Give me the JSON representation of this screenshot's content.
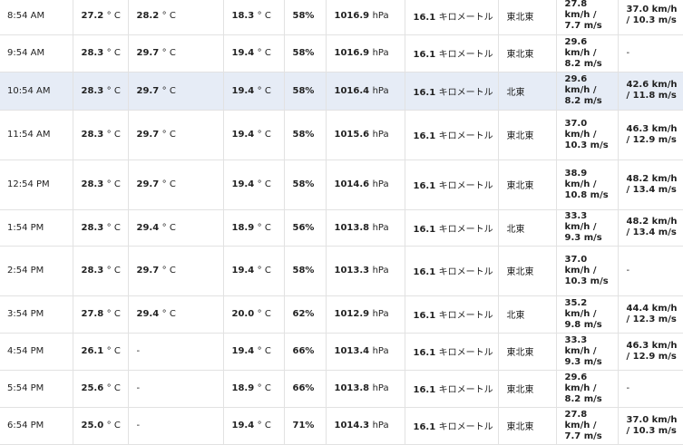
{
  "rows": [
    {
      "time": "8:54 AM",
      "temp": "27.2",
      "heat": "28.2",
      "dew": "18.3",
      "hum": "58%",
      "pres": "1016.9",
      "vis": "16.1",
      "vis_unit": "キロメートル",
      "dir": "東北東",
      "wind": "27.8 km/h / 7.7 m/s",
      "gust": "37.0 km/h / 10.3 m/s",
      "highlight": false
    },
    {
      "time": "9:54 AM",
      "temp": "28.3",
      "heat": "29.7",
      "dew": "19.4",
      "hum": "58%",
      "pres": "1016.9",
      "vis": "16.1",
      "vis_unit": "キロメートル",
      "dir": "東北東",
      "wind": "29.6 km/h / 8.2 m/s",
      "gust": "-",
      "highlight": false
    },
    {
      "time": "10:54 AM",
      "temp": "28.3",
      "heat": "29.7",
      "dew": "19.4",
      "hum": "58%",
      "pres": "1016.4",
      "vis": "16.1",
      "vis_unit": "キロメートル",
      "dir": "北東",
      "wind": "29.6 km/h / 8.2 m/s",
      "gust": "42.6 km/h / 11.8 m/s",
      "highlight": true
    },
    {
      "time": "11:54 AM",
      "temp": "28.3",
      "heat": "29.7",
      "dew": "19.4",
      "hum": "58%",
      "pres": "1015.6",
      "vis": "16.1",
      "vis_unit": "キロメートル",
      "dir": "東北東",
      "wind": "37.0 km/h / 10.3 m/s",
      "gust": "46.3 km/h / 12.9 m/s",
      "highlight": false
    },
    {
      "time": "12:54 PM",
      "temp": "28.3",
      "heat": "29.7",
      "dew": "19.4",
      "hum": "58%",
      "pres": "1014.6",
      "vis": "16.1",
      "vis_unit": "キロメートル",
      "dir": "東北東",
      "wind": "38.9 km/h / 10.8 m/s",
      "gust": "48.2 km/h / 13.4 m/s",
      "highlight": false
    },
    {
      "time": "1:54 PM",
      "temp": "28.3",
      "heat": "29.4",
      "dew": "18.9",
      "hum": "56%",
      "pres": "1013.8",
      "vis": "16.1",
      "vis_unit": "キロメートル",
      "dir": "北東",
      "wind": "33.3 km/h / 9.3 m/s",
      "gust": "48.2 km/h / 13.4 m/s",
      "highlight": false
    },
    {
      "time": "2:54 PM",
      "temp": "28.3",
      "heat": "29.7",
      "dew": "19.4",
      "hum": "58%",
      "pres": "1013.3",
      "vis": "16.1",
      "vis_unit": "キロメートル",
      "dir": "東北東",
      "wind": "37.0 km/h / 10.3 m/s",
      "gust": "-",
      "highlight": false
    },
    {
      "time": "3:54 PM",
      "temp": "27.8",
      "heat": "29.4",
      "dew": "20.0",
      "hum": "62%",
      "pres": "1012.9",
      "vis": "16.1",
      "vis_unit": "キロメートル",
      "dir": "北東",
      "wind": "35.2 km/h / 9.8 m/s",
      "gust": "44.4 km/h / 12.3 m/s",
      "highlight": false
    },
    {
      "time": "4:54 PM",
      "temp": "26.1",
      "heat": "-",
      "dew": "19.4",
      "hum": "66%",
      "pres": "1013.4",
      "vis": "16.1",
      "vis_unit": "キロメートル",
      "dir": "東北東",
      "wind": "33.3 km/h / 9.3 m/s",
      "gust": "46.3 km/h / 12.9 m/s",
      "highlight": false
    },
    {
      "time": "5:54 PM",
      "temp": "25.6",
      "heat": "-",
      "dew": "18.9",
      "hum": "66%",
      "pres": "1013.8",
      "vis": "16.1",
      "vis_unit": "キロメートル",
      "dir": "東北東",
      "wind": "29.6 km/h / 8.2 m/s",
      "gust": "-",
      "highlight": false
    },
    {
      "time": "6:54 PM",
      "temp": "25.0",
      "heat": "-",
      "dew": "19.4",
      "hum": "71%",
      "pres": "1014.3",
      "vis": "16.1",
      "vis_unit": "キロメートル",
      "dir": "東北東",
      "wind": "27.8 km/h / 7.7 m/s",
      "gust": "37.0 km/h / 10.3 m/s",
      "highlight": false
    }
  ],
  "units": {
    "temp": "° C",
    "pres": "hPa"
  },
  "colors": {
    "highlight_row": "#e6ecf6",
    "grid": "#e2e2e2"
  }
}
